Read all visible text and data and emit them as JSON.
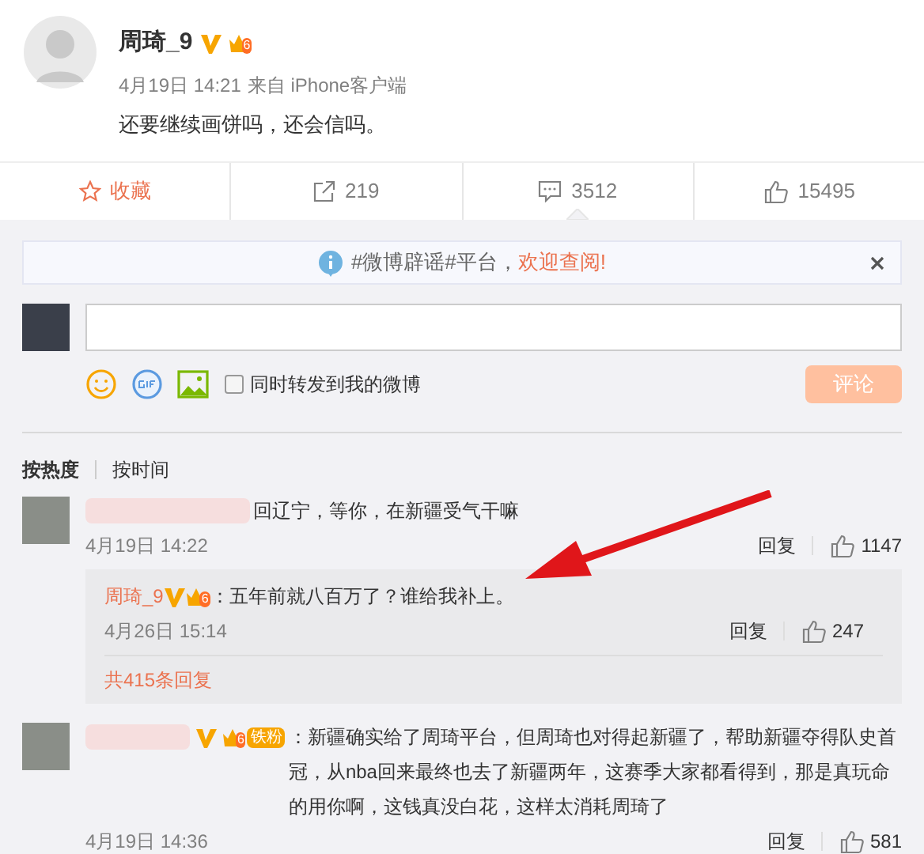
{
  "post": {
    "author": "周琦_9",
    "verified": true,
    "member_level": "6",
    "time": "4月19日 14:21",
    "source": "来自 iPhone客户端",
    "text": "还要继续画饼吗，还会信吗。"
  },
  "actions": [
    {
      "kind": "favorite",
      "label": "收藏",
      "selected": false
    },
    {
      "kind": "repost",
      "label": "219",
      "selected": false
    },
    {
      "kind": "comment",
      "label": "3512",
      "selected": true
    },
    {
      "kind": "like",
      "label": "15495",
      "selected": false
    }
  ],
  "notice": {
    "text": "#微博辟谣#平台，",
    "link": "欢迎查阅!"
  },
  "composer": {
    "repost_label": "同时转发到我的微博",
    "repost_checked": false,
    "submit": "评论",
    "submit_disabled": true
  },
  "sort_tabs": [
    {
      "label": "按热度",
      "selected": true
    },
    {
      "label": "按时间",
      "selected": false
    }
  ],
  "comments": [
    {
      "text": "回辽宁，等你，在新疆受气干嘛",
      "time": "4月19日 14:22",
      "reply": "回复",
      "likes": "1147",
      "replies": [
        {
          "author": "周琦_9",
          "member_level": "6",
          "text": "：五年前就八百万了？谁给我补上。",
          "time": "4月26日 15:14",
          "reply": "回复",
          "likes": "247"
        }
      ],
      "more": "共415条回复"
    },
    {
      "text": "：新疆确实给了周琦平台，但周琦也对得起新疆了，帮助新疆夺得队史首冠，从nba回来最终也去了新疆两年，这赛季大家都看得到，那是真玩命的用你啊，这钱真没白花，这样太消耗周琦了",
      "time": "4月19日 14:36",
      "reply": "回复",
      "likes": "581",
      "member_level": "6",
      "badge": "铁粉"
    }
  ]
}
